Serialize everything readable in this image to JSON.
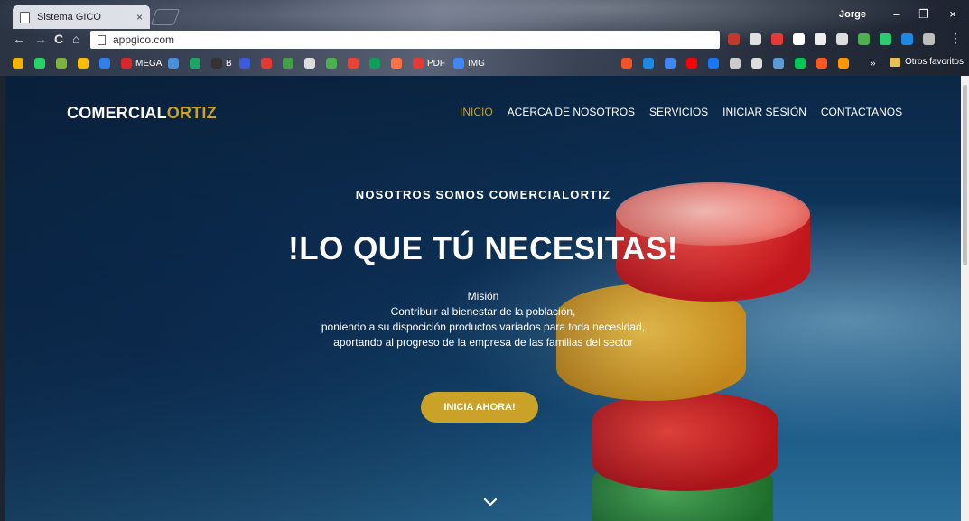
{
  "browser": {
    "tab_title": "Sistema GICO",
    "tab_close": "×",
    "profile_name": "Jorge",
    "url": "appgico.com",
    "window_controls": {
      "minimize": "–",
      "restore": "❐",
      "close": "×"
    },
    "nav": {
      "back": "←",
      "forward": "→",
      "reload": "C",
      "home": "⌂",
      "menu": "⋮"
    },
    "bookmarks": [
      {
        "label": "",
        "icon": "drive-icon",
        "color": "#f4b400"
      },
      {
        "label": "",
        "icon": "whatsapp-icon",
        "color": "#25d366"
      },
      {
        "label": "",
        "icon": "plant-icon",
        "color": "#7cb342"
      },
      {
        "label": "",
        "icon": "keep-icon",
        "color": "#fbbc04"
      },
      {
        "label": "",
        "icon": "blue-b-icon",
        "color": "#2f80ed"
      },
      {
        "label": "MEGA",
        "icon": "mega-icon",
        "color": "#d9272e"
      },
      {
        "label": "",
        "icon": "doc-icon",
        "color": "#4a90d9"
      },
      {
        "label": "",
        "icon": "excel-icon",
        "color": "#21a366"
      },
      {
        "label": "B",
        "icon": "b-icon",
        "color": "#333333"
      },
      {
        "label": "",
        "icon": "s-icon",
        "color": "#3b5bdb"
      },
      {
        "label": "",
        "icon": "tomato-icon",
        "color": "#e53935"
      },
      {
        "label": "",
        "icon": "arrow-icon",
        "color": "#43a047"
      },
      {
        "label": "",
        "icon": "page-icon",
        "color": "#dddddd"
      },
      {
        "label": "",
        "icon": "green-circle-icon",
        "color": "#4caf50"
      },
      {
        "label": "",
        "icon": "photos-icon",
        "color": "#ea4335"
      },
      {
        "label": "",
        "icon": "sheet-icon",
        "color": "#0f9d58"
      },
      {
        "label": "",
        "icon": "orange-icon",
        "color": "#ff7043"
      },
      {
        "label": "PDF",
        "icon": "pdf-icon",
        "color": "#e53935"
      },
      {
        "label": "IMG",
        "icon": "img-icon",
        "color": "#4285f4"
      }
    ],
    "bookmarks_right": [
      {
        "icon": "windows-icon",
        "color": "#f35325"
      },
      {
        "icon": "blue-square-icon",
        "color": "#1e88e5"
      },
      {
        "icon": "translate-icon",
        "color": "#4285f4"
      },
      {
        "icon": "youtube-icon",
        "color": "#ff0000"
      },
      {
        "icon": "facebook-icon",
        "color": "#1877f2"
      },
      {
        "icon": "eye-icon",
        "color": "#cccccc"
      },
      {
        "icon": "image-icon",
        "color": "#dddddd"
      },
      {
        "icon": "teams-icon",
        "color": "#5b9bd5"
      },
      {
        "icon": "play-icon",
        "color": "#00c853"
      },
      {
        "icon": "blogger-icon",
        "color": "#ff5722"
      },
      {
        "icon": "info-icon",
        "color": "#ff9800"
      }
    ],
    "bookmarks_overflow": "»",
    "other_bookmarks": "Otros favoritos"
  },
  "site": {
    "logo_main": "COMERCIAL",
    "logo_accent": "ORTIZ",
    "nav": [
      {
        "label": "INICIO",
        "active": true
      },
      {
        "label": "ACERCA DE NOSOTROS",
        "active": false
      },
      {
        "label": "SERVICIOS",
        "active": false
      },
      {
        "label": "INICIAR SESIÓN",
        "active": false
      },
      {
        "label": "CONTACTANOS",
        "active": false
      }
    ],
    "hero_subtitle": "NOSOTROS SOMOS COMERCIALORTIZ",
    "hero_title": "!LO QUE TÚ NECESITAS!",
    "mission_lines": [
      "Misión",
      "Contribuir al bienestar de la población,",
      "poniendo a su dispocición productos variados para toda necesidad,",
      "aportando al progreso de la empresa de las familias del sector"
    ],
    "cta_label": "INICIA AHORA!",
    "accent_color": "#c9a227"
  }
}
